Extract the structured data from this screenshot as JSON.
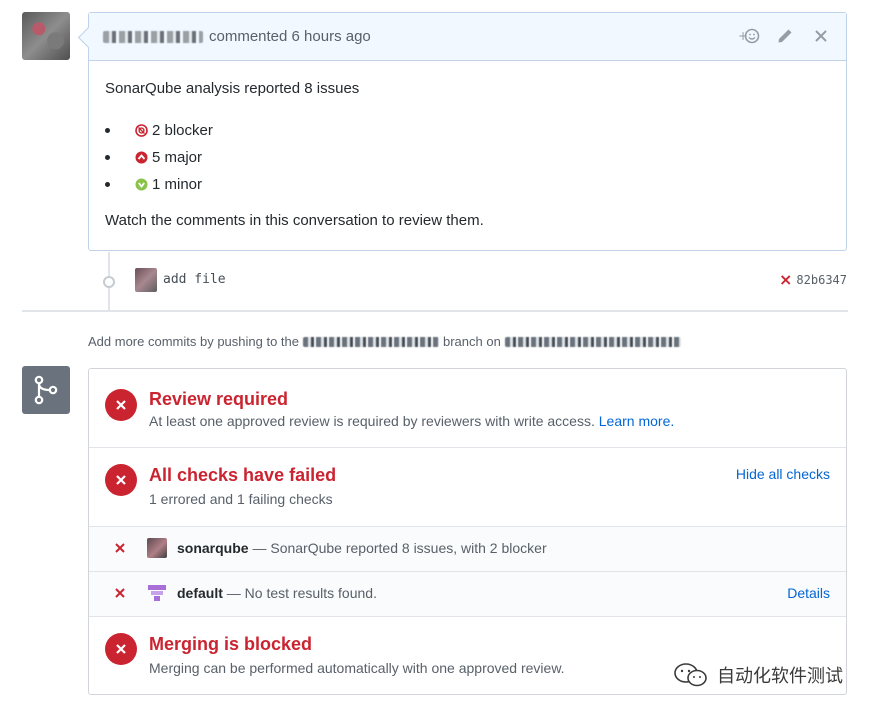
{
  "comment": {
    "author_suffix": "commented 6 hours ago",
    "title": "SonarQube analysis reported 8 issues",
    "issues": [
      {
        "label": "2 blocker",
        "color": "#cb2431",
        "icon": "blocker-icon"
      },
      {
        "label": "5 major",
        "color": "#cb2431",
        "icon": "major-icon"
      },
      {
        "label": "1 minor",
        "color": "#7fbf3f",
        "icon": "minor-icon"
      }
    ],
    "footer": "Watch the comments in this conversation to review them."
  },
  "commit": {
    "message": "add file",
    "sha": "82b6347"
  },
  "push_hint": {
    "prefix": "Add more commits by pushing to the",
    "middle": "branch on"
  },
  "merge": {
    "review": {
      "title": "Review required",
      "desc": "At least one approved review is required by reviewers with write access.",
      "link": "Learn more."
    },
    "checks": {
      "title": "All checks have failed",
      "desc": "1 errored and 1 failing checks",
      "toggle": "Hide all checks"
    },
    "check_items": [
      {
        "name": "sonarqube",
        "desc": " — SonarQube reported 8 issues, with 2 blocker",
        "details": ""
      },
      {
        "name": "default",
        "desc": " — No test results found.",
        "details": "Details"
      }
    ],
    "blocked": {
      "title": "Merging is blocked",
      "desc": "Merging can be performed automatically with one approved review."
    }
  },
  "watermark": "自动化软件测试",
  "colors": {
    "error": "#cb2431",
    "link": "#0366d6",
    "muted": "#586069",
    "header_bg": "#f1f8ff"
  }
}
